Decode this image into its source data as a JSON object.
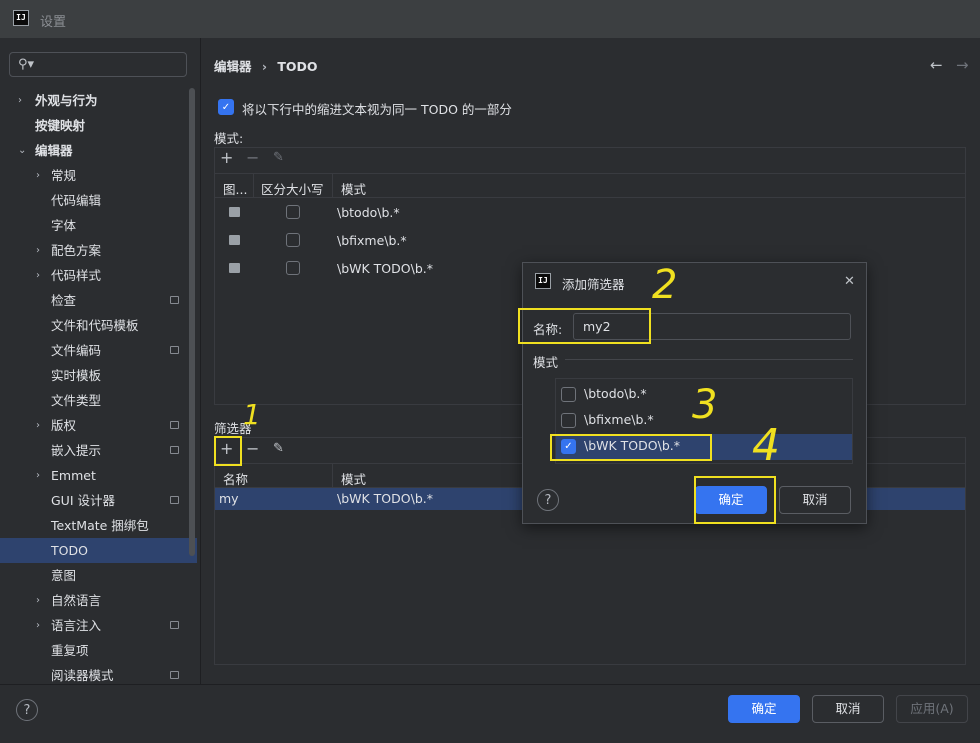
{
  "window": {
    "title": "设置",
    "logo": "IJ"
  },
  "search": {
    "icon": "search-icon"
  },
  "sidebar": {
    "items": [
      {
        "label": "外观与行为",
        "bold": true,
        "chev": "›",
        "indent": 0
      },
      {
        "label": "按键映射",
        "bold": true,
        "chev": "",
        "indent": 0
      },
      {
        "label": "编辑器",
        "bold": true,
        "chev": "⌄",
        "indent": 0
      },
      {
        "label": "常规",
        "bold": false,
        "chev": "›",
        "indent": 1
      },
      {
        "label": "代码编辑",
        "bold": false,
        "chev": "",
        "indent": 1
      },
      {
        "label": "字体",
        "bold": false,
        "chev": "",
        "indent": 1
      },
      {
        "label": "配色方案",
        "bold": false,
        "chev": "›",
        "indent": 1
      },
      {
        "label": "代码样式",
        "bold": false,
        "chev": "›",
        "indent": 1
      },
      {
        "label": "检查",
        "bold": false,
        "chev": "",
        "indent": 1,
        "page": true
      },
      {
        "label": "文件和代码模板",
        "bold": false,
        "chev": "",
        "indent": 1
      },
      {
        "label": "文件编码",
        "bold": false,
        "chev": "",
        "indent": 1,
        "page": true
      },
      {
        "label": "实时模板",
        "bold": false,
        "chev": "",
        "indent": 1
      },
      {
        "label": "文件类型",
        "bold": false,
        "chev": "",
        "indent": 1
      },
      {
        "label": "版权",
        "bold": false,
        "chev": "›",
        "indent": 1,
        "page": true
      },
      {
        "label": "嵌入提示",
        "bold": false,
        "chev": "",
        "indent": 1,
        "page": true
      },
      {
        "label": "Emmet",
        "bold": false,
        "chev": "›",
        "indent": 1
      },
      {
        "label": "GUI 设计器",
        "bold": false,
        "chev": "",
        "indent": 1,
        "page": true
      },
      {
        "label": "TextMate 捆绑包",
        "bold": false,
        "chev": "",
        "indent": 1
      },
      {
        "label": "TODO",
        "bold": false,
        "chev": "",
        "indent": 1,
        "selected": true
      },
      {
        "label": "意图",
        "bold": false,
        "chev": "",
        "indent": 1
      },
      {
        "label": "自然语言",
        "bold": false,
        "chev": "›",
        "indent": 1
      },
      {
        "label": "语言注入",
        "bold": false,
        "chev": "›",
        "indent": 1,
        "page": true
      },
      {
        "label": "重复项",
        "bold": false,
        "chev": "",
        "indent": 1
      },
      {
        "label": "阅读器模式",
        "bold": false,
        "chev": "",
        "indent": 1,
        "page": true
      }
    ]
  },
  "breadcrumb": {
    "parent": "编辑器",
    "sep": "›",
    "current": "TODO",
    "back": "←",
    "forward": "→"
  },
  "option": {
    "label": "将以下行中的缩进文本视为同一 TODO 的一部分",
    "checked": true
  },
  "patterns": {
    "section_label": "模式:",
    "toolbar": {
      "add": "+",
      "remove": "−",
      "edit": "✎"
    },
    "columns": {
      "icon": "图...",
      "case": "区分大小写",
      "pattern": "模式"
    },
    "rows": [
      {
        "pattern": "\\btodo\\b.*",
        "case": false
      },
      {
        "pattern": "\\bfixme\\b.*",
        "case": false
      },
      {
        "pattern": "\\bWK TODO\\b.*",
        "case": false
      }
    ]
  },
  "filters": {
    "section_label": "筛选器",
    "toolbar": {
      "add": "+",
      "remove": "−",
      "edit": "✎"
    },
    "columns": {
      "name": "名称",
      "pattern": "模式"
    },
    "rows": [
      {
        "name": "my",
        "pattern": "\\bWK TODO\\b.*"
      }
    ]
  },
  "dialog": {
    "title": "添加筛选器",
    "close": "✕",
    "name_label": "名称:",
    "name_value": "my2",
    "patterns_label": "模式",
    "patterns": [
      {
        "label": "\\btodo\\b.*",
        "checked": false
      },
      {
        "label": "\\bfixme\\b.*",
        "checked": false
      },
      {
        "label": "\\bWK TODO\\b.*",
        "checked": true
      }
    ],
    "help": "?",
    "ok": "确定",
    "cancel": "取消"
  },
  "footer": {
    "help": "?",
    "ok": "确定",
    "cancel": "取消",
    "apply": "应用(A)"
  },
  "annotations": {
    "n1": "1",
    "n2": "2",
    "n3": "3",
    "n4": "4",
    "color": "#f0e020"
  },
  "colors": {
    "accent": "#3574f0",
    "selection": "#2e436e",
    "background": "#2b2d30"
  }
}
